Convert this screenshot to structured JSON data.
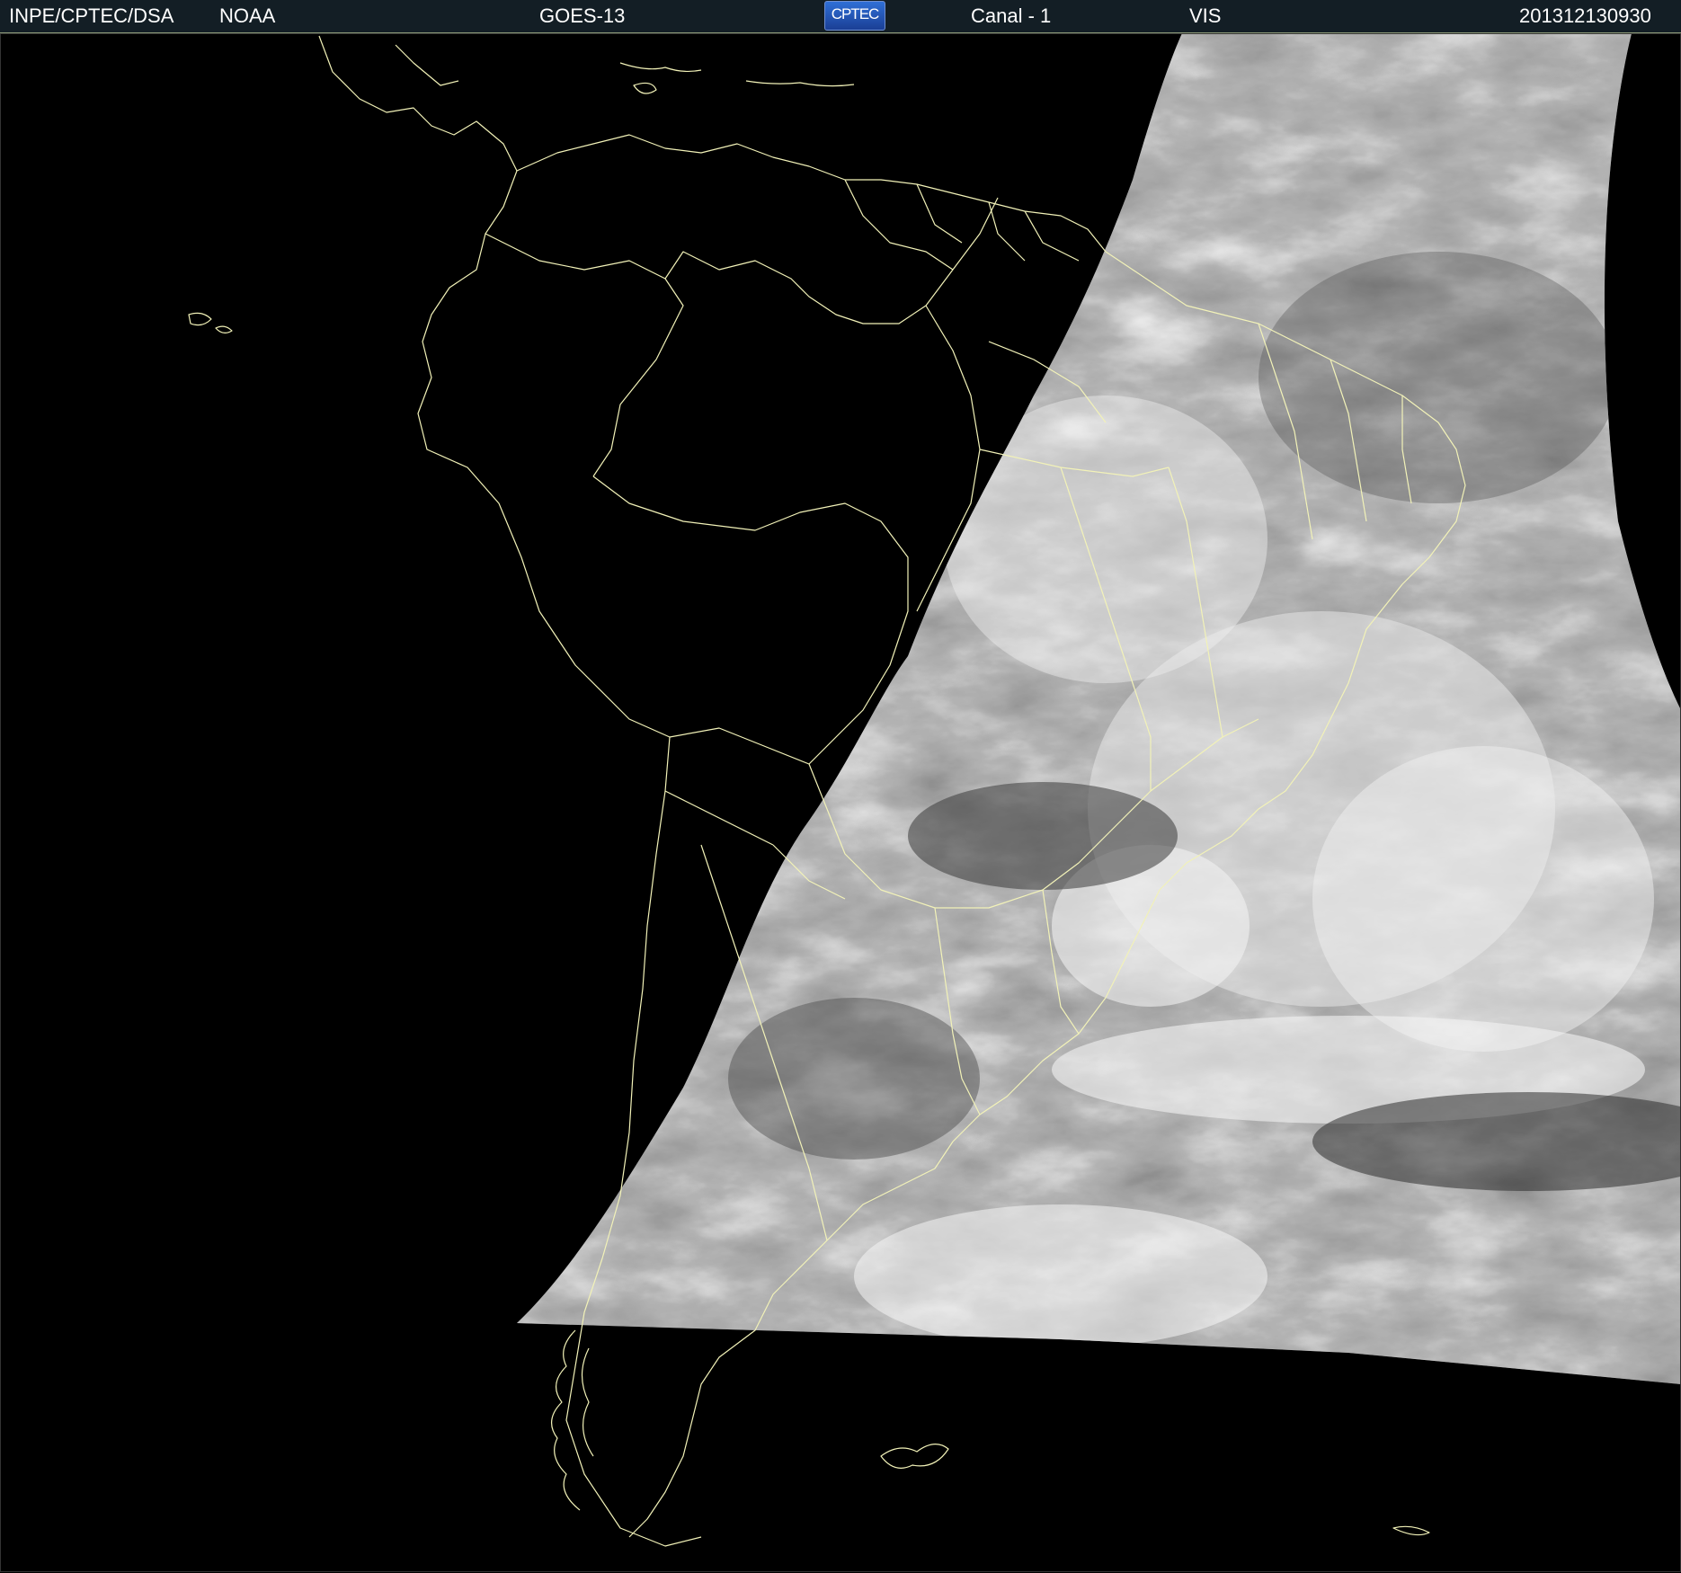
{
  "header": {
    "agency": "INPE/CPTEC/DSA",
    "source": "NOAA",
    "satellite": "GOES-13",
    "logo_text": "CPTEC",
    "channel": "Canal - 1",
    "band": "VIS",
    "timestamp": "201312130930"
  },
  "map": {
    "image_type": "satellite visible imagery",
    "border_color": "#f2f2b8",
    "background_color": "#000000"
  }
}
